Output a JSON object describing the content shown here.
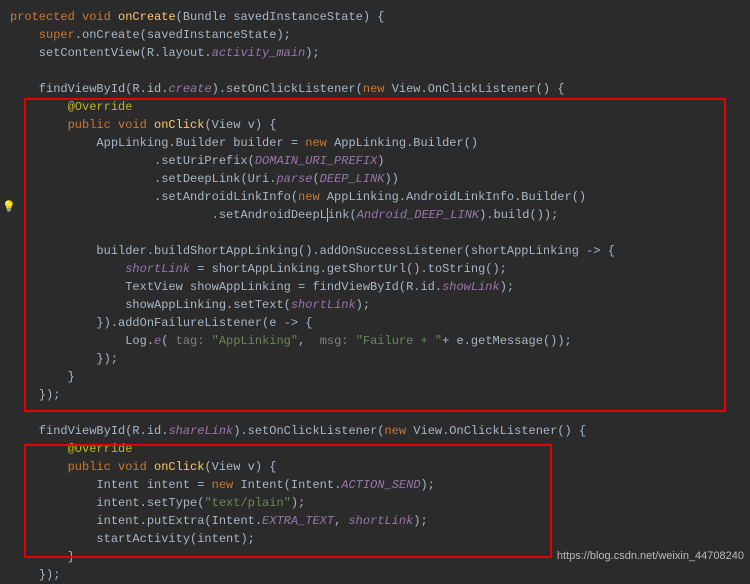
{
  "watermark": "https://blog.csdn.net/weixin_44708240",
  "lines": {
    "l1_a": "protected void ",
    "l1_b": "onCreate",
    "l1_c": "(Bundle savedInstanceState) {",
    "l2_a": "    ",
    "l2_b": "super",
    "l2_c": ".onCreate(savedInstanceState);",
    "l3_a": "    setContentView(R.layout.",
    "l3_b": "activity_main",
    "l3_c": ");",
    "l4": "",
    "l5_a": "    findViewById(R.id.",
    "l5_b": "create",
    "l5_c": ").setOnClickListener(",
    "l5_d": "new ",
    "l5_e": "View.OnClickListener() {",
    "l6_a": "        ",
    "l6_b": "@Override",
    "l7_a": "        ",
    "l7_b": "public void ",
    "l7_c": "onClick",
    "l7_d": "(View v) {",
    "l8_a": "            AppLinking.Builder builder = ",
    "l8_b": "new ",
    "l8_c": "AppLinking.Builder()",
    "l9_a": "                    .setUriPrefix(",
    "l9_b": "DOMAIN_URI_PREFIX",
    "l9_c": ")",
    "l10_a": "                    .setDeepLink(Uri.",
    "l10_b": "parse",
    "l10_c": "(",
    "l10_d": "DEEP_LINK",
    "l10_e": "))",
    "l11_a": "                    .setAndroidLinkInfo(",
    "l11_b": "new ",
    "l11_c": "AppLinking.AndroidLinkInfo.Builder()",
    "l12_a": "                            .setAndroidDeepL",
    "l12_b": "ink(",
    "l12_c": "Android_DEEP_LINK",
    "l12_d": ").build());",
    "l13": "",
    "l14_a": "            builder.buildShortAppLinking().addOnSuccessListener(shortAppLinking -> {",
    "l15_a": "                ",
    "l15_b": "shortLink",
    "l15_c": " = shortAppLinking.getShortUrl().toString();",
    "l16_a": "                TextView showAppLinking = findViewById(R.id.",
    "l16_b": "showLink",
    "l16_c": ");",
    "l17_a": "                showAppLinking.setText(",
    "l17_b": "shortLink",
    "l17_c": ");",
    "l18_a": "            }).addOnFailureListener(e -> {",
    "l19_a": "                Log.",
    "l19_b": "e",
    "l19_c": "( ",
    "l19_d": "tag: ",
    "l19_e": "\"AppLinking\"",
    "l19_f": ",  ",
    "l19_g": "msg: ",
    "l19_h": "\"Failure + \"",
    "l19_i": "+ e.getMessage());",
    "l20_a": "            });",
    "l21_a": "        }",
    "l22_a": "    });",
    "l23": "",
    "l24_a": "    findViewById(R.id.",
    "l24_b": "shareLink",
    "l24_c": ").setOnClickListener(",
    "l24_d": "new ",
    "l24_e": "View.OnClickListener() {",
    "l25_a": "        ",
    "l25_b": "@Override",
    "l26_a": "        ",
    "l26_b": "public void ",
    "l26_c": "onClick",
    "l26_d": "(View v) {",
    "l27_a": "            Intent intent = ",
    "l27_b": "new ",
    "l27_c": "Intent(Intent.",
    "l27_d": "ACTION_SEND",
    "l27_e": ");",
    "l28_a": "            intent.setType(",
    "l28_b": "\"text/plain\"",
    "l28_c": ");",
    "l29_a": "            intent.putExtra(Intent.",
    "l29_b": "EXTRA_TEXT",
    "l29_c": ", ",
    "l29_d": "shortLink",
    "l29_e": ");",
    "l30_a": "            startActivity(intent);",
    "l31_a": "        }",
    "l32_a": "    });"
  }
}
